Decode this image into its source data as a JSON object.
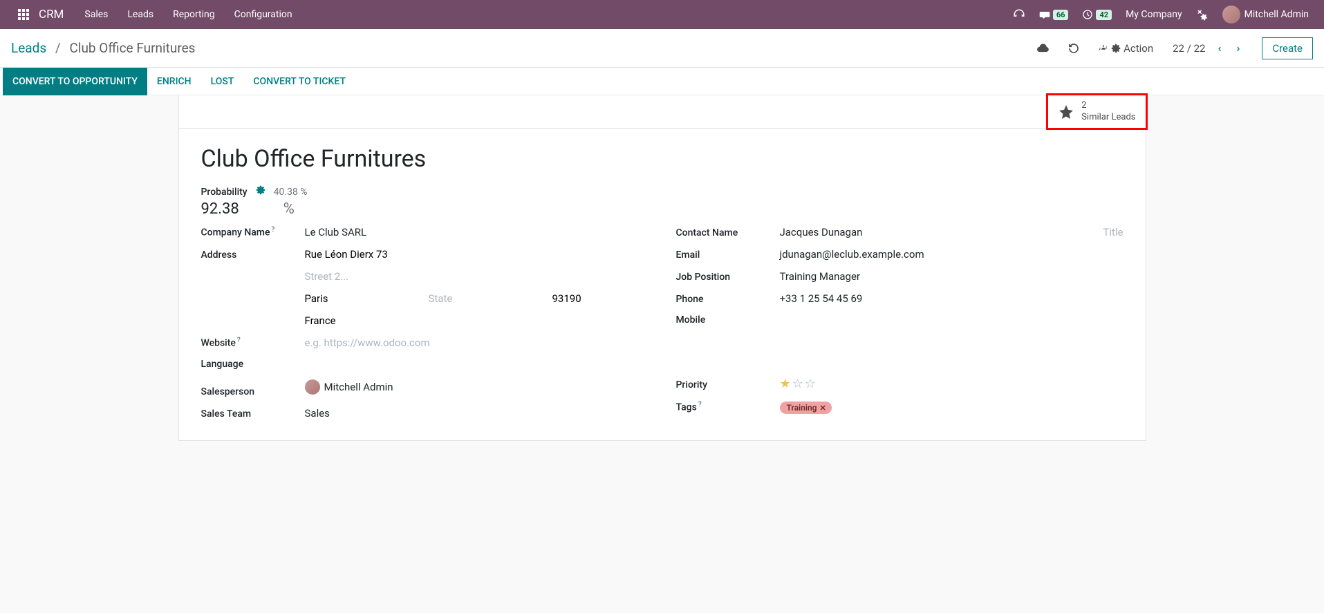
{
  "navbar": {
    "brand": "CRM",
    "menu": [
      "Sales",
      "Leads",
      "Reporting",
      "Configuration"
    ],
    "messages_badge": "66",
    "activities_badge": "42",
    "company": "My Company",
    "user": "Mitchell Admin"
  },
  "controlbar": {
    "breadcrumb_root": "Leads",
    "breadcrumb_current": "Club Office Furnitures",
    "action_label": "Action",
    "pager": "22 / 22",
    "create_label": "Create"
  },
  "statusbar": {
    "convert_opp": "CONVERT TO OPPORTUNITY",
    "enrich": "ENRICH",
    "lost": "LOST",
    "convert_ticket": "CONVERT TO TICKET"
  },
  "stat_button": {
    "count": "2",
    "label": "Similar Leads"
  },
  "lead": {
    "title": "Club Office Furnitures",
    "probability_label": "Probability",
    "probability_auto": "40.38 %",
    "probability": "92.38",
    "probability_symbol": "%",
    "labels": {
      "company": "Company Name",
      "address": "Address",
      "website": "Website",
      "language": "Language",
      "salesperson": "Salesperson",
      "sales_team": "Sales Team",
      "contact_name": "Contact Name",
      "email": "Email",
      "job_position": "Job Position",
      "phone": "Phone",
      "mobile": "Mobile",
      "priority": "Priority",
      "tags": "Tags"
    },
    "company_name": "Le Club SARL",
    "street": "Rue Léon Dierx 73",
    "street2_placeholder": "Street 2...",
    "city": "Paris",
    "state_placeholder": "State",
    "zip": "93190",
    "country": "France",
    "website_placeholder": "e.g. https://www.odoo.com",
    "language": "",
    "salesperson": "Mitchell Admin",
    "sales_team": "Sales",
    "contact_name": "Jacques Dunagan",
    "contact_title_placeholder": "Title",
    "email": "jdunagan@leclub.example.com",
    "job_position": "Training Manager",
    "phone": "+33 1 25 54 45 69",
    "mobile": "",
    "priority": 1,
    "tags": [
      "Training"
    ]
  }
}
